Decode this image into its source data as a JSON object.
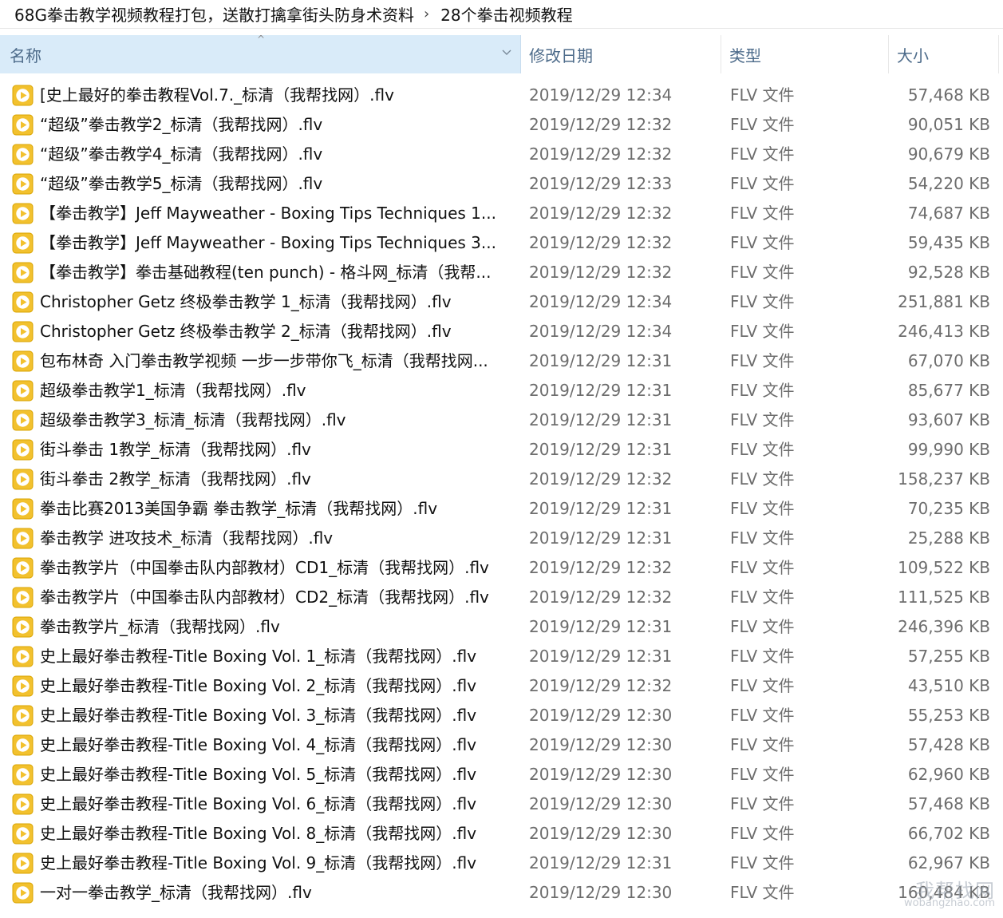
{
  "breadcrumb": {
    "items": [
      "68G拳击教学视频教程打包，送散打擒拿街头防身术资料",
      "28个拳击视频教程"
    ],
    "separator": "›"
  },
  "columns": {
    "name": "名称",
    "date": "修改日期",
    "type": "类型",
    "size": "大小"
  },
  "colors": {
    "header_selected_bg": "#d9ebf9",
    "header_text": "#4d6b8a",
    "icon_fill": "#f2c12e",
    "icon_border": "#d9a400"
  },
  "icons": {
    "file_icon": "media-file-icon",
    "sort": "sort-up-icon",
    "dropdown": "chevron-down-icon"
  },
  "files": [
    {
      "name": "[史上最好的拳击教程Vol.7._标清（我帮找网）.flv",
      "date": "2019/12/29 12:34",
      "type": "FLV 文件",
      "size": "57,468 KB"
    },
    {
      "name": "“超级”拳击教学2_标清（我帮找网）.flv",
      "date": "2019/12/29 12:32",
      "type": "FLV 文件",
      "size": "90,051 KB"
    },
    {
      "name": "“超级”拳击教学4_标清（我帮找网）.flv",
      "date": "2019/12/29 12:32",
      "type": "FLV 文件",
      "size": "90,679 KB"
    },
    {
      "name": "“超级”拳击教学5_标清（我帮找网）.flv",
      "date": "2019/12/29 12:33",
      "type": "FLV 文件",
      "size": "54,220 KB"
    },
    {
      "name": "【拳击教学】Jeff Mayweather - Boxing Tips  Techniques 1...",
      "date": "2019/12/29 12:32",
      "type": "FLV 文件",
      "size": "74,687 KB"
    },
    {
      "name": "【拳击教学】Jeff Mayweather - Boxing Tips  Techniques 3...",
      "date": "2019/12/29 12:32",
      "type": "FLV 文件",
      "size": "59,435 KB"
    },
    {
      "name": "【拳击教学】拳击基础教程(ten punch) - 格斗网_标清（我帮...",
      "date": "2019/12/29 12:32",
      "type": "FLV 文件",
      "size": "92,528 KB"
    },
    {
      "name": "Christopher Getz 终极拳击教学  1_标清（我帮找网）.flv",
      "date": "2019/12/29 12:34",
      "type": "FLV 文件",
      "size": "251,881 KB"
    },
    {
      "name": "Christopher Getz 终极拳击教学 2_标清（我帮找网）.flv",
      "date": "2019/12/29 12:34",
      "type": "FLV 文件",
      "size": "246,413 KB"
    },
    {
      "name": "包布林奇 入门拳击教学视频 一步一步带你飞_标清（我帮找网...",
      "date": "2019/12/29 12:31",
      "type": "FLV 文件",
      "size": "67,070 KB"
    },
    {
      "name": "超级拳击教学1_标清（我帮找网）.flv",
      "date": "2019/12/29 12:31",
      "type": "FLV 文件",
      "size": "85,677 KB"
    },
    {
      "name": "超级拳击教学3_标清_标清（我帮找网）.flv",
      "date": "2019/12/29 12:31",
      "type": "FLV 文件",
      "size": "93,607 KB"
    },
    {
      "name": "街斗拳击  1教学_标清（我帮找网）.flv",
      "date": "2019/12/29 12:31",
      "type": "FLV 文件",
      "size": "99,990 KB"
    },
    {
      "name": "街斗拳击  2教学_标清（我帮找网）.flv",
      "date": "2019/12/29 12:32",
      "type": "FLV 文件",
      "size": "158,237 KB"
    },
    {
      "name": "拳击比赛2013美国争霸  拳击教学_标清（我帮找网）.flv",
      "date": "2019/12/29 12:31",
      "type": "FLV 文件",
      "size": "70,235 KB"
    },
    {
      "name": "拳击教学 进攻技术_标清（我帮找网）.flv",
      "date": "2019/12/29 12:31",
      "type": "FLV 文件",
      "size": "25,288 KB"
    },
    {
      "name": "拳击教学片（中国拳击队内部教材）CD1_标清（我帮找网）.flv",
      "date": "2019/12/29 12:32",
      "type": "FLV 文件",
      "size": "109,522 KB"
    },
    {
      "name": "拳击教学片（中国拳击队内部教材）CD2_标清（我帮找网）.flv",
      "date": "2019/12/29 12:32",
      "type": "FLV 文件",
      "size": "111,525 KB"
    },
    {
      "name": "拳击教学片_标清（我帮找网）.flv",
      "date": "2019/12/29 12:31",
      "type": "FLV 文件",
      "size": "246,396 KB"
    },
    {
      "name": "史上最好拳击教程-Title Boxing Vol. 1_标清（我帮找网）.flv",
      "date": "2019/12/29 12:31",
      "type": "FLV 文件",
      "size": "57,255 KB"
    },
    {
      "name": "史上最好拳击教程-Title Boxing Vol. 2_标清（我帮找网）.flv",
      "date": "2019/12/29 12:32",
      "type": "FLV 文件",
      "size": "43,510 KB"
    },
    {
      "name": "史上最好拳击教程-Title Boxing Vol. 3_标清（我帮找网）.flv",
      "date": "2019/12/29 12:30",
      "type": "FLV 文件",
      "size": "55,253 KB"
    },
    {
      "name": "史上最好拳击教程-Title Boxing Vol. 4_标清（我帮找网）.flv",
      "date": "2019/12/29 12:30",
      "type": "FLV 文件",
      "size": "57,428 KB"
    },
    {
      "name": "史上最好拳击教程-Title Boxing Vol. 5_标清（我帮找网）.flv",
      "date": "2019/12/29 12:30",
      "type": "FLV 文件",
      "size": "62,960 KB"
    },
    {
      "name": "史上最好拳击教程-Title Boxing Vol. 6_标清（我帮找网）.flv",
      "date": "2019/12/29 12:30",
      "type": "FLV 文件",
      "size": "57,468 KB"
    },
    {
      "name": "史上最好拳击教程-Title Boxing Vol. 8_标清（我帮找网）.flv",
      "date": "2019/12/29 12:30",
      "type": "FLV 文件",
      "size": "66,702 KB"
    },
    {
      "name": "史上最好拳击教程-Title Boxing Vol. 9_标清（我帮找网）.flv",
      "date": "2019/12/29 12:31",
      "type": "FLV 文件",
      "size": "62,967 KB"
    },
    {
      "name": "一对一拳击教学_标清（我帮找网）.flv",
      "date": "2019/12/29 12:30",
      "type": "FLV 文件",
      "size": "160,484 KB"
    }
  ],
  "watermark": {
    "text": "我帮找网",
    "url": "wobangzhao.com"
  }
}
